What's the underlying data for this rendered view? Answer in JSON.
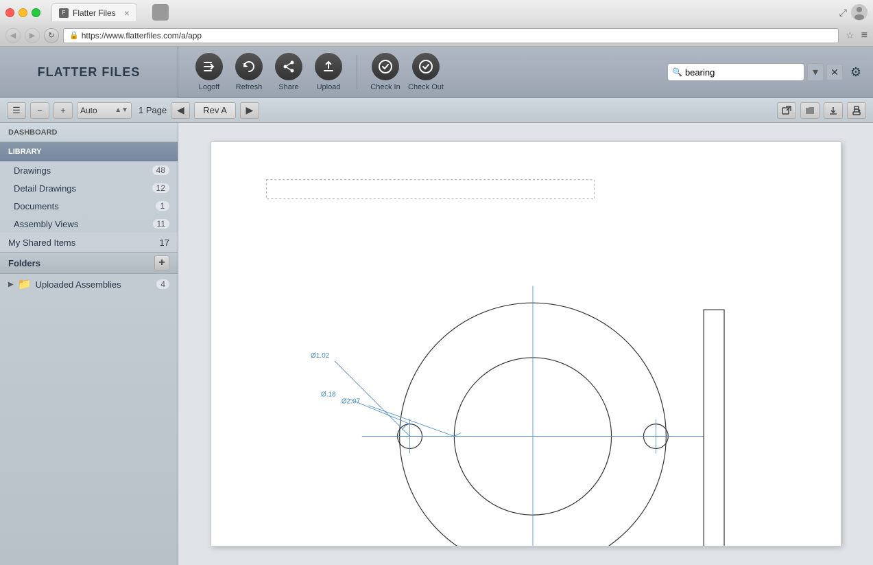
{
  "browser": {
    "url": "https://www.flatterfiles.com/a/app",
    "tab_title": "Flatter Files",
    "back_disabled": false,
    "forward_disabled": true
  },
  "toolbar": {
    "app_title": "FLATTER FILES",
    "buttons": [
      {
        "id": "logoff",
        "label": "Logoff",
        "icon": "🔓"
      },
      {
        "id": "refresh",
        "label": "Refresh",
        "icon": "↻"
      },
      {
        "id": "share",
        "label": "Share",
        "icon": "→"
      },
      {
        "id": "upload",
        "label": "Upload",
        "icon": "↑"
      },
      {
        "id": "checkin",
        "label": "Check In",
        "icon": "✓"
      },
      {
        "id": "checkout",
        "label": "Check Out",
        "icon": "✓"
      }
    ],
    "search_value": "bearing",
    "search_placeholder": "Search"
  },
  "view_toolbar": {
    "zoom": "Auto",
    "page_info": "1 Page",
    "revision": "Rev A",
    "prev_label": "◀",
    "next_label": "▶"
  },
  "sidebar": {
    "dashboard_label": "DASHBOARD",
    "library_label": "LIBRARY",
    "library_items": [
      {
        "name": "Drawings",
        "count": "48"
      },
      {
        "name": "Detail Drawings",
        "count": "12"
      },
      {
        "name": "Documents",
        "count": "1"
      },
      {
        "name": "Assembly Views",
        "count": "11"
      }
    ],
    "shared_label": "My Shared Items",
    "shared_count": "17",
    "folders_label": "Folders",
    "folders": [
      {
        "name": "Uploaded Assemblies",
        "count": "4"
      }
    ]
  },
  "drawing": {
    "dim1": "Ø1.02",
    "dim2": "Ø2.07",
    "dim3": "Ø.18"
  }
}
